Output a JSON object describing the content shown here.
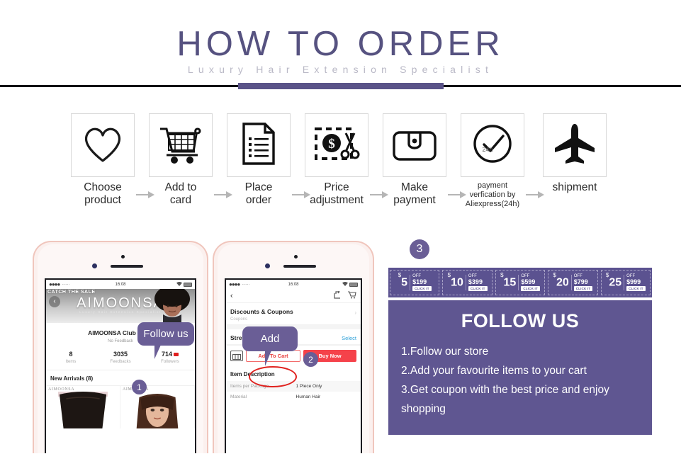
{
  "header": {
    "title": "HOW TO ORDER",
    "subtitle": "Luxury Hair Extension Specialist",
    "accent_color": "#5a5388",
    "title_color": "#565280"
  },
  "steps": [
    {
      "icon": "heart-icon",
      "label": "Choose\nproduct",
      "small": false
    },
    {
      "icon": "cart-icon",
      "label": "Add to\ncard",
      "small": false
    },
    {
      "icon": "document-icon",
      "label": "Place\norder",
      "small": false
    },
    {
      "icon": "price-cut-icon",
      "label": "Price\nadjustment",
      "small": false
    },
    {
      "icon": "wallet-icon",
      "label": "Make\npayment",
      "small": false
    },
    {
      "icon": "clock-24h-icon",
      "label": "payment\nverfication by\nAliexpress(24h)",
      "small": true
    },
    {
      "icon": "airplane-icon",
      "label": "shipment",
      "small": false
    }
  ],
  "phone1": {
    "status": {
      "carrier": "······",
      "time": "16:08"
    },
    "sale_badge": "CATCH THE SALE",
    "back_icon": "back-chevron-icon",
    "store_name": "AIMOONSA",
    "store_tagline": "Luxury Hair Extension Specialist",
    "store_sub": "AIMOONSA Club Store",
    "feedback": "No Feedback",
    "stats": [
      {
        "num": "8",
        "label": "Items"
      },
      {
        "num": "3035",
        "label": "Feedbacks"
      },
      {
        "num": "714",
        "label": "Followers",
        "flag": true
      }
    ],
    "arrivals": "New Arrivals (8)",
    "watermark": "AIMOONSA",
    "bubble": "Follow us",
    "badge": "1"
  },
  "phone2": {
    "status": {
      "carrier": "······",
      "time": "16:08"
    },
    "back_icon": "back-chevron-icon",
    "share_icon": "share-icon",
    "cart_icon": "cart-icon",
    "coupons_title": "Discounts & Coupons",
    "coupons_sub": "Coupons",
    "length_title": "Stretched Length",
    "length_action": "Select",
    "shop_icon": "storefront-icon",
    "add_to_cart": "Add To Cart",
    "buy_now": "Buy Now",
    "desc_title": "Item Description",
    "desc_rows": [
      {
        "k": "Items per Package",
        "v": "1 Piece Only"
      },
      {
        "k": "Material",
        "v": "Human Hair"
      }
    ],
    "bubble": "Add",
    "badge": "2"
  },
  "right": {
    "badge": "3",
    "coupons": [
      {
        "amount": "5",
        "currency": "$",
        "off": "OFF",
        "min": "$199",
        "cta": "CLICK IT"
      },
      {
        "amount": "10",
        "currency": "$",
        "off": "OFF",
        "min": "$399",
        "cta": "CLICK IT"
      },
      {
        "amount": "15",
        "currency": "$",
        "off": "OFF",
        "min": "$599",
        "cta": "CLICK IT"
      },
      {
        "amount": "20",
        "currency": "$",
        "off": "OFF",
        "min": "$799",
        "cta": "CLICK IT"
      },
      {
        "amount": "25",
        "currency": "$",
        "off": "OFF",
        "min": "$999",
        "cta": "CLICK IT"
      }
    ],
    "follow": {
      "title": "FOLLOW US",
      "items": [
        "1.Follow our store",
        "2.Add your favourite items to your cart",
        "3.Get coupon with the best price and enjoy shopping"
      ]
    },
    "panel_color": "#5f5691",
    "coupon_bar_color": "#5b5290"
  }
}
